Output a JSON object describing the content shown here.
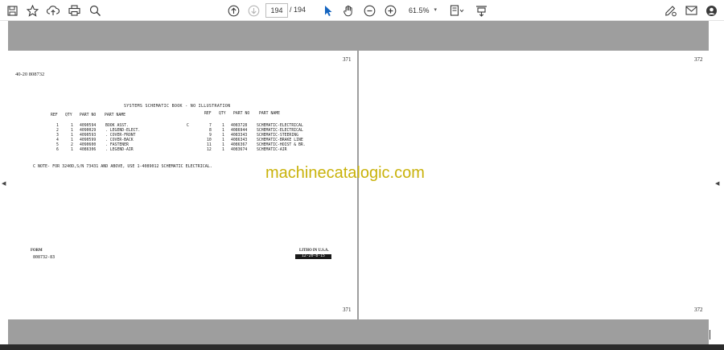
{
  "toolbar": {
    "current_page": "194",
    "page_separator": "/",
    "total_pages": "194",
    "zoom": "61.5%",
    "icons": [
      "save-icon",
      "bookmark-star-icon",
      "upload-cloud-icon",
      "print-icon",
      "zoom-search-icon",
      "page-up-icon",
      "page-down-icon",
      "select-cursor-icon",
      "hand-pan-icon",
      "zoom-out-icon",
      "zoom-in-icon",
      "page-fit-icon",
      "scroll-mode-icon",
      "annotate-sign-icon",
      "email-icon",
      "account-icon"
    ]
  },
  "pages": {
    "left": {
      "page_number_top": "371",
      "page_number_bottom": "371",
      "sheet_id": "40-20  808732",
      "title": "SYSTEMS SCHEMATIC BOOK - NO ILLUSTRATION",
      "columns_left": [
        "REF",
        "QTY",
        "PART NO",
        "PART NAME"
      ],
      "columns_right": [
        "REF",
        "QTY",
        "PART NO",
        "PART NAME"
      ],
      "rows_left": [
        {
          "ref": "1",
          "qty": "1",
          "part_no": "4090594",
          "name": "BOOK ASST."
        },
        {
          "ref": "2",
          "qty": "1",
          "part_no": "4090029",
          "name": ". LEGEND-ELECT."
        },
        {
          "ref": "3",
          "qty": "1",
          "part_no": "4090593",
          "name": ". COVER-FRONT"
        },
        {
          "ref": "4",
          "qty": "1",
          "part_no": "4090599",
          "name": ". COVER-BACK"
        },
        {
          "ref": "5",
          "qty": "2",
          "part_no": "4090600",
          "name": ". FASTENER"
        },
        {
          "ref": "6",
          "qty": "1",
          "part_no": "4086306",
          "name": ". LEGEND-AIR"
        }
      ],
      "c_marker": "C",
      "rows_right": [
        {
          "ref": "7",
          "qty": "1",
          "part_no": "4083728",
          "name": "SCHEMATIC-ELECTRICAL"
        },
        {
          "ref": "8",
          "qty": "1",
          "part_no": "4086944",
          "name": "SCHEMATIC-ELECTRICAL"
        },
        {
          "ref": "9",
          "qty": "1",
          "part_no": "4083343",
          "name": "SCHEMATIC-STEERING"
        },
        {
          "ref": "10",
          "qty": "1",
          "part_no": "4086343",
          "name": "SCHEMATIC-BRAKE LINE"
        },
        {
          "ref": "11",
          "qty": "1",
          "part_no": "4086367",
          "name": "SCHEMATIC-HOIST & BR."
        },
        {
          "ref": "12",
          "qty": "1",
          "part_no": "4083674",
          "name": "SCHEMATIC-AIR"
        }
      ],
      "note": "C  NOTE- FOR 3240D,S/N 73431 AND ABOVE, USE 1-4089012 SCHEMATIC ELECTRICAL.",
      "form_label": "FORM",
      "form_code": "808732-83",
      "litho": "LITHO IN U.S.A.",
      "litho_date": "12-20-8-15"
    },
    "right": {
      "page_number_top": "372",
      "page_number_bottom": "372"
    }
  },
  "watermark": "machinecatalogic.com",
  "colors": {
    "viewer_background": "#9e9e9e",
    "watermark": "#c9b20a",
    "toolbar_icon": "#3a3a3a",
    "select_cursor_active": "#1565c0"
  }
}
